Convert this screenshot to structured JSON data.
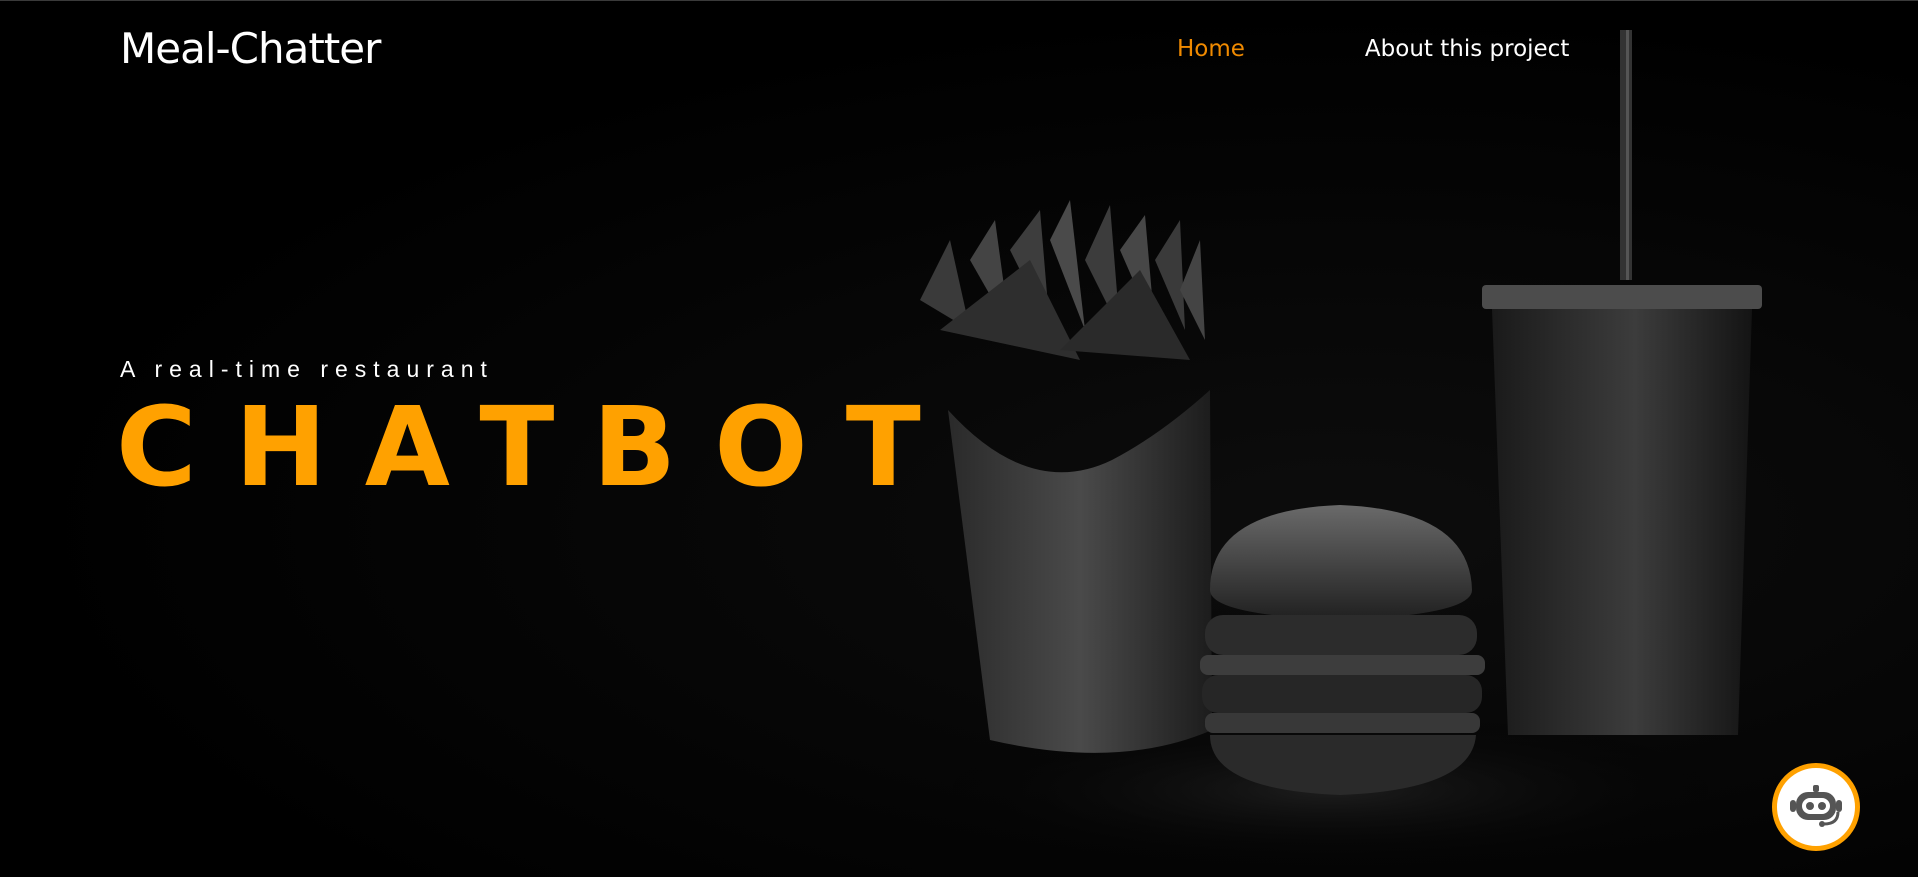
{
  "header": {
    "logo": "Meal-Chatter",
    "nav": [
      {
        "label": "Home",
        "active": true
      },
      {
        "label": "About this project",
        "active": false
      }
    ]
  },
  "hero": {
    "subtitle": "A real-time restaurant",
    "headline": "CHATBOT"
  },
  "chat_widget": {
    "icon": "robot-headset-icon"
  },
  "colors": {
    "background": "#000000",
    "accent": "#ffa100",
    "nav_active": "#f08a00",
    "text": "#ffffff"
  }
}
